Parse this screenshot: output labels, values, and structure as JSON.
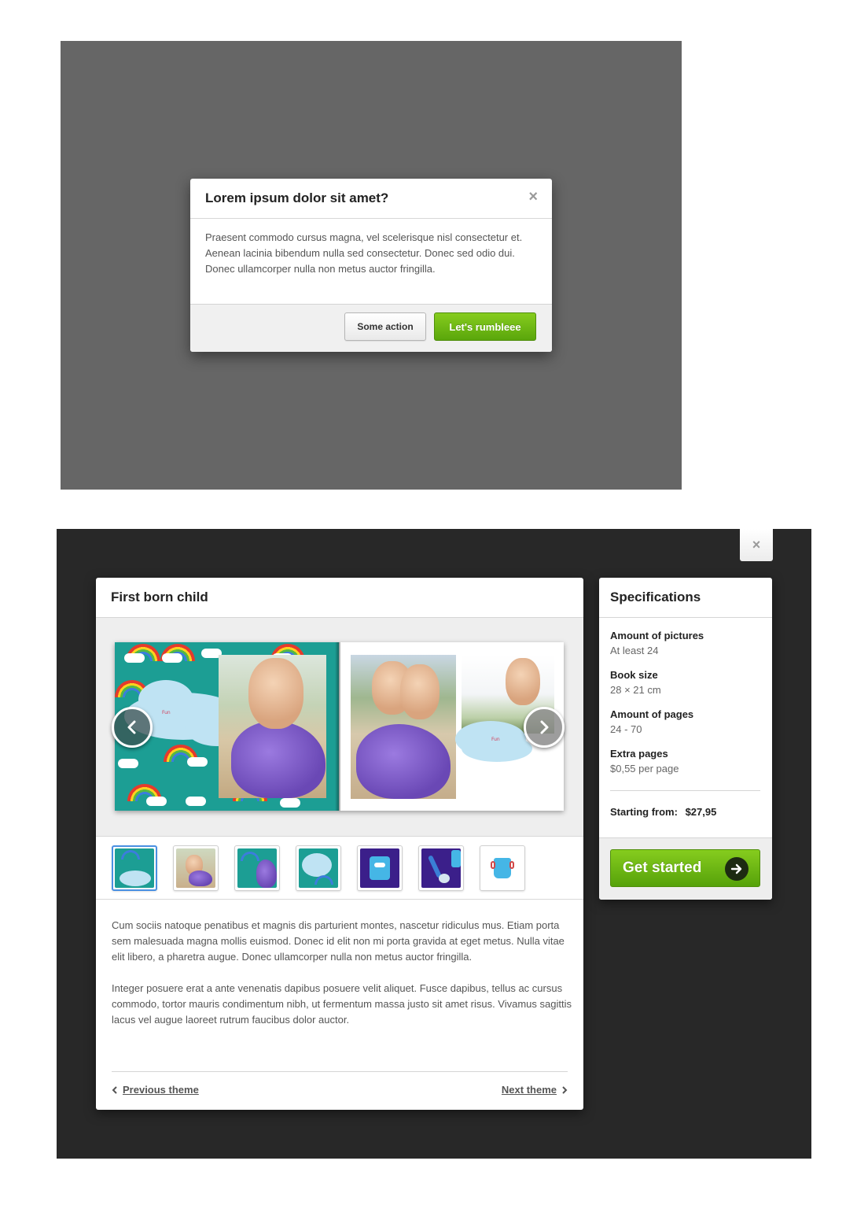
{
  "dialog": {
    "title": "Lorem ipsum dolor sit amet?",
    "close_symbol": "×",
    "body": "Praesent commodo cursus magna, vel scelerisque nisl consectetur et. Aenean lacinia bibendum nulla sed consectetur. Donec sed odio dui. Donec ullamcorper nulla non metus auctor fringilla.",
    "secondary_button": "Some action",
    "primary_button": "Let's rumbleee",
    "overlay_color": "#666666",
    "primary_color": "#6db514"
  },
  "theme_viewer": {
    "close_symbol": "×",
    "title": "First born child",
    "preview": {
      "left_page_label": "Fun",
      "right_page_label": "Fun",
      "prev_icon": "chevron-left-icon",
      "next_icon": "chevron-right-icon"
    },
    "thumbnails": [
      {
        "name": "rainbow-cloud-page",
        "selected": true
      },
      {
        "name": "kid-photo-page",
        "selected": false
      },
      {
        "name": "rainbow-dino-page",
        "selected": false
      },
      {
        "name": "cloud-page",
        "selected": false
      },
      {
        "name": "blue-cup-monster-page",
        "selected": false
      },
      {
        "name": "spoon-page",
        "selected": false
      },
      {
        "name": "blue-cup-page",
        "selected": false
      }
    ],
    "paragraphs": [
      "Cum sociis natoque penatibus et magnis dis parturient montes, nascetur ridiculus mus. Etiam porta sem malesuada magna mollis euismod. Donec id elit non mi porta gravida at eget metus. Nulla vitae elit libero, a pharetra augue. Donec ullamcorper nulla non metus auctor fringilla.",
      "Integer posuere erat a ante venenatis dapibus posuere velit aliquet. Fusce dapibus, tellus ac cursus commodo, tortor mauris condimentum nibh, ut fermentum massa justo sit amet risus. Vivamus sagittis lacus vel augue laoreet rutrum faucibus dolor auctor."
    ],
    "previous_link": "Previous theme",
    "next_link": "Next theme"
  },
  "specifications": {
    "title": "Specifications",
    "items": [
      {
        "label": "Amount of pictures",
        "value": "At least 24"
      },
      {
        "label": "Book size",
        "value": "28 × 21 cm"
      },
      {
        "label": "Amount of pages",
        "value": "24 - 70"
      },
      {
        "label": "Extra pages",
        "value": "$0,55 per page"
      }
    ],
    "price_label": "Starting from:",
    "price_value": "$27,95",
    "cta_label": "Get started",
    "cta_icon": "arrow-right-circle-icon"
  }
}
